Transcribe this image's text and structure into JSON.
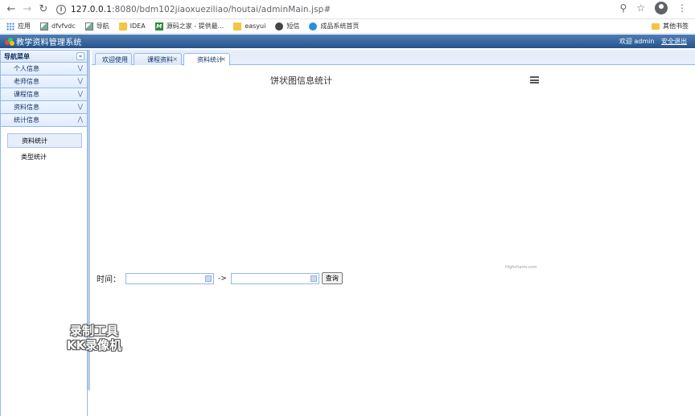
{
  "browser": {
    "url_host": "127.0.0.1",
    "url_path": ":8080/bdm102jiaoxueziliao/houtai/adminMain.jsp#",
    "bookmarks": [
      "应用",
      "dfvfvdc",
      "导航",
      "IDEA",
      "源码之家 - 提供最...",
      "easyui",
      "短信",
      "成品系统首页"
    ],
    "other_bookmarks": "其他书签"
  },
  "header": {
    "title": "教学资料管理系统",
    "welcome": "欢迎 admin",
    "logout": "安全退出"
  },
  "sidebar": {
    "title": "导航菜单",
    "sections": [
      "个人信息",
      "老师信息",
      "课程信息",
      "资料信息",
      "统计信息"
    ],
    "items": [
      "资料统计",
      "类型统计"
    ]
  },
  "tabs": [
    "欢迎使用",
    "课程资料",
    "资料统计"
  ],
  "chart": {
    "title": "饼状图信息统计",
    "credit": "Highcharts.com"
  },
  "filter": {
    "time_label": "时间：",
    "arrow": "->",
    "query_button": "查询"
  },
  "watermark": [
    "录制工具",
    "KK录像机"
  ]
}
